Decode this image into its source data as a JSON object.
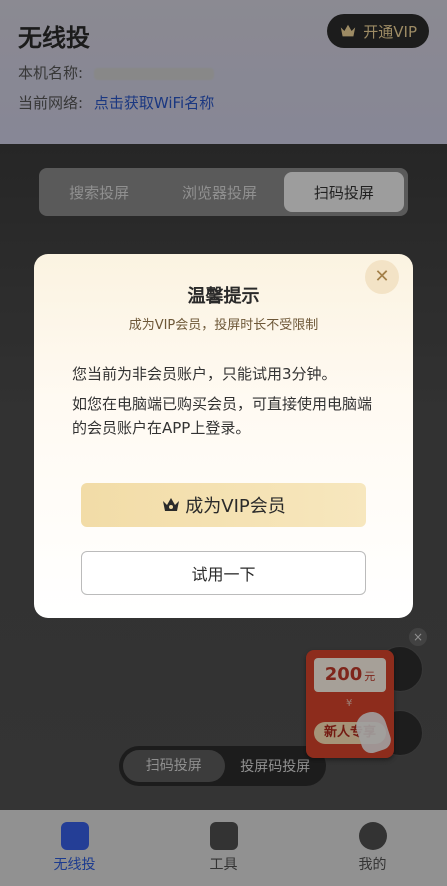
{
  "header": {
    "title": "无线投",
    "vip_button": "开通VIP",
    "device_label": "本机名称:",
    "network_label": "当前网络:",
    "network_link": "点击获取WiFi名称"
  },
  "tabs": [
    "搜索投屏",
    "浏览器投屏",
    "扫码投屏"
  ],
  "bottom_segment": [
    "扫码投屏",
    "投屏码投屏"
  ],
  "promo": {
    "amount": "200",
    "unit": "元",
    "tag": "新人专享",
    "yen": "¥"
  },
  "modal": {
    "title": "温馨提示",
    "subtitle": "成为VIP会员，投屏时长不受限制",
    "line1": "您当前为非会员账户，只能试用3分钟。",
    "line2": "如您在电脑端已购买会员，可直接使用电脑端的会员账户在APP上登录。",
    "primary_button": "成为VIP会员",
    "secondary_button": "试用一下",
    "close_symbol": "✕"
  },
  "navbar": [
    "无线投",
    "工具",
    "我的"
  ],
  "colors": {
    "accent_blue": "#2a56c6",
    "vip_gold": "#f2dca7",
    "promo_red": "#d9442c"
  }
}
